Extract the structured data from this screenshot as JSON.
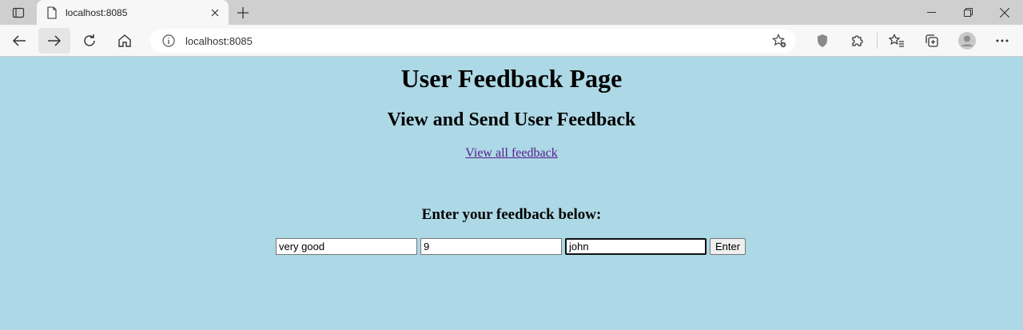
{
  "browser": {
    "tab_title": "localhost:8085",
    "address": "localhost:8085"
  },
  "page": {
    "heading": "User Feedback Page",
    "subheading": "View and Send User Feedback",
    "view_link": "View all feedback",
    "form_heading": "Enter your feedback below:",
    "feedback_value": "very good",
    "rating_value": "9",
    "name_value": "john",
    "submit_label": "Enter"
  },
  "colors": {
    "page_background": "#add8e6",
    "link": "#551a8b"
  }
}
